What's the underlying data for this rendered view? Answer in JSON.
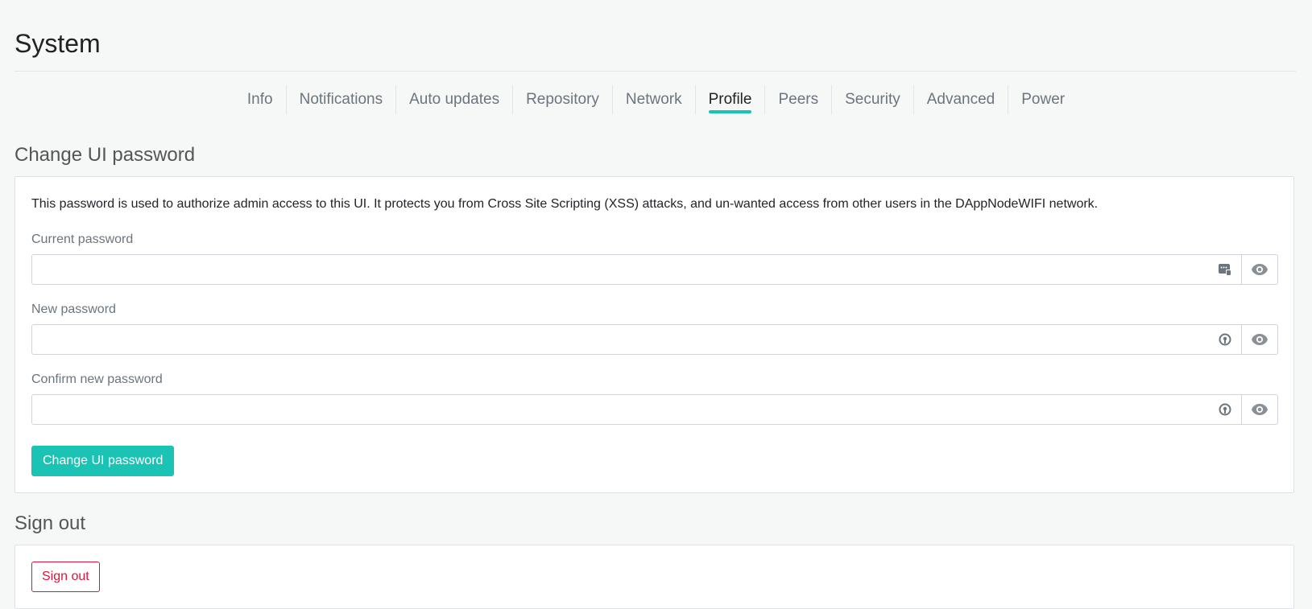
{
  "page": {
    "title": "System"
  },
  "tabs": [
    {
      "label": "Info",
      "active": false
    },
    {
      "label": "Notifications",
      "active": false
    },
    {
      "label": "Auto updates",
      "active": false
    },
    {
      "label": "Repository",
      "active": false
    },
    {
      "label": "Network",
      "active": false
    },
    {
      "label": "Profile",
      "active": true
    },
    {
      "label": "Peers",
      "active": false
    },
    {
      "label": "Security",
      "active": false
    },
    {
      "label": "Advanced",
      "active": false
    },
    {
      "label": "Power",
      "active": false
    }
  ],
  "change_password": {
    "title": "Change UI password",
    "description": "This password is used to authorize admin access to this UI. It protects you from Cross Site Scripting (XSS) attacks, and un-wanted access from other users in the DAppNodeWIFI network.",
    "fields": [
      {
        "label": "Current password",
        "value": "",
        "icon": "password-manager-icon"
      },
      {
        "label": "New password",
        "value": "",
        "icon": "key-generator-icon"
      },
      {
        "label": "Confirm new password",
        "value": "",
        "icon": "key-generator-icon"
      }
    ],
    "submit_label": "Change UI password"
  },
  "sign_out": {
    "title": "Sign out",
    "button_label": "Sign out"
  },
  "colors": {
    "accent": "#1bc3b4",
    "danger": "#dc143c",
    "background": "#f6f7f7"
  }
}
